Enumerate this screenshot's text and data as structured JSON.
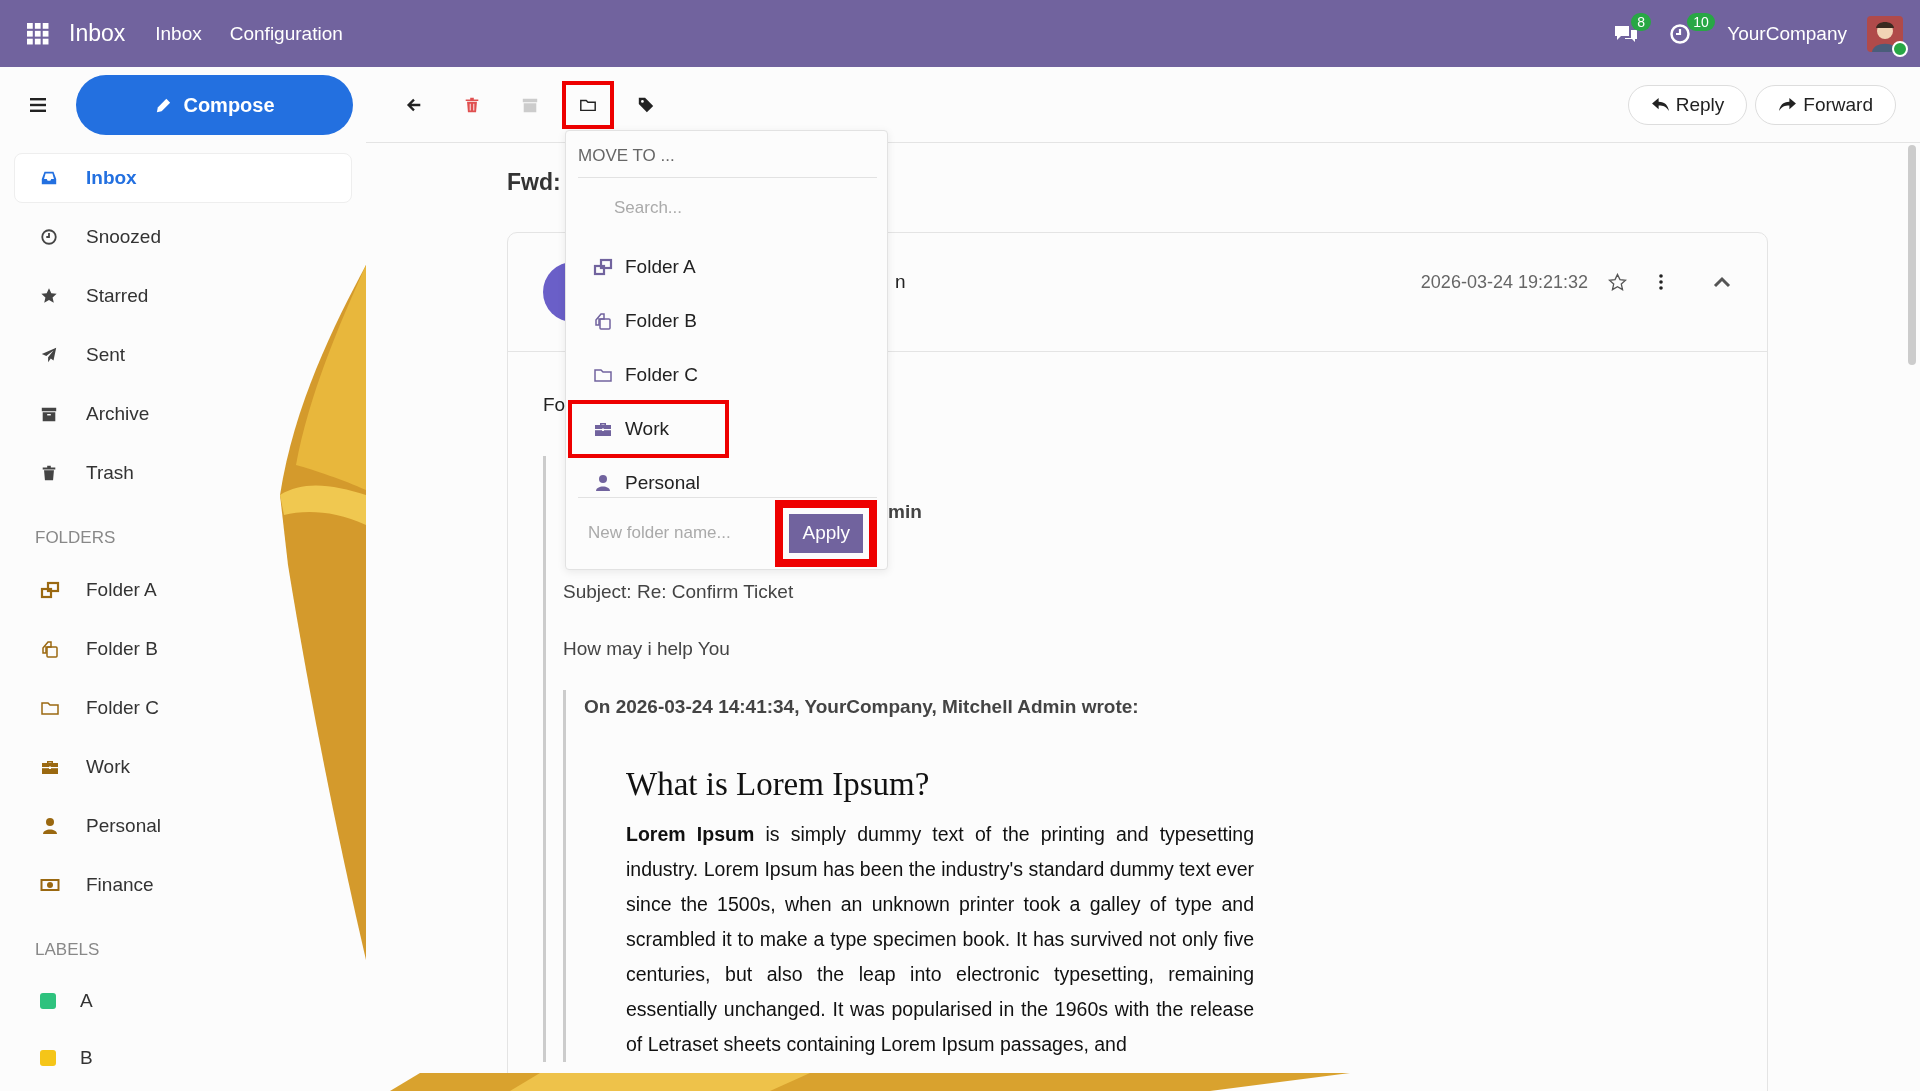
{
  "topbar": {
    "app_name": "Inbox",
    "menu": [
      "Inbox",
      "Configuration"
    ],
    "chat_badge": "8",
    "activity_badge": "10",
    "company": "YourCompany"
  },
  "sidebar": {
    "compose": "Compose",
    "nav": [
      {
        "label": "Inbox",
        "selected": true
      },
      {
        "label": "Snoozed",
        "selected": false
      },
      {
        "label": "Starred",
        "selected": false
      },
      {
        "label": "Sent",
        "selected": false
      },
      {
        "label": "Archive",
        "selected": false
      },
      {
        "label": "Trash",
        "selected": false
      }
    ],
    "folders_heading": "FOLDERS",
    "folders": [
      "Folder A",
      "Folder B",
      "Folder C",
      "Work",
      "Personal",
      "Finance"
    ],
    "labels_heading": "LABELS",
    "labels": [
      {
        "label": "A",
        "color": "#2ec27e"
      },
      {
        "label": "B",
        "color": "#f5c518"
      }
    ]
  },
  "toolbar": {
    "buttons": [
      {
        "highlighted": false
      },
      {
        "highlighted": false
      },
      {
        "highlighted": false
      },
      {
        "highlighted": true
      },
      {
        "highlighted": false
      }
    ],
    "reply": "Reply",
    "forward": "Forward"
  },
  "message": {
    "subject": "Fwd:",
    "sender_fragment": "n",
    "date": "2026-03-24 19:21:32",
    "body_fragment": "Fo",
    "quoted_fragment": "min",
    "subject_line": "Subject: Re: Confirm Ticket",
    "reply_text": "How may i help You",
    "quote_header": "On 2026-03-24 14:41:34, YourCompany, Mitchell Admin wrote:",
    "heading": "What is Lorem Ipsum?",
    "paragraph": "**Lorem Ipsum** is simply dummy text of the printing and typesetting industry. Lorem Ipsum has been the industry's standard dummy text ever since the 1500s, when an unknown printer took a galley of type and scrambled it to make a type specimen book. It has survived not only five centuries, but also the leap into electronic typesetting, remaining essentially unchanged. It was popularised in the 1960s with the release of Letraset sheets containing Lorem Ipsum passages, and"
  },
  "move_menu": {
    "title": "MOVE TO ...",
    "search_placeholder": "Search...",
    "items": [
      {
        "label": "Folder A",
        "highlighted": false
      },
      {
        "label": "Folder B",
        "highlighted": false
      },
      {
        "label": "Folder C",
        "highlighted": false
      },
      {
        "label": "Work",
        "highlighted": true
      },
      {
        "label": "Personal",
        "highlighted": false
      }
    ],
    "new_folder_placeholder": "New folder name...",
    "apply": "Apply",
    "apply_highlighted": true
  }
}
